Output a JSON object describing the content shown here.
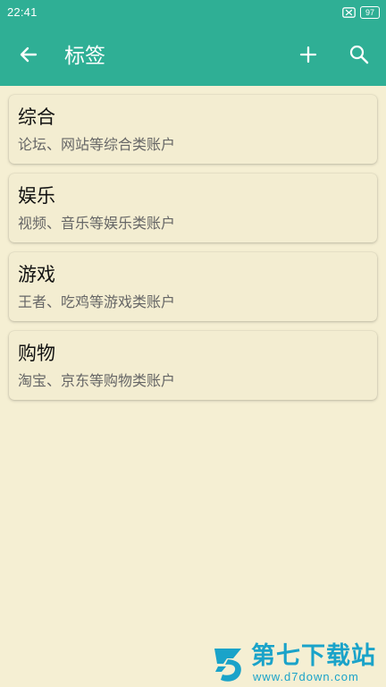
{
  "status_bar": {
    "time": "22:41",
    "battery": "97"
  },
  "app_bar": {
    "title": "标签",
    "icons": {
      "back": "arrow-left",
      "add": "plus",
      "search": "search"
    }
  },
  "tags": [
    {
      "title": "综合",
      "subtitle": "论坛、网站等综合类账户"
    },
    {
      "title": "娱乐",
      "subtitle": "视频、音乐等娱乐类账户"
    },
    {
      "title": "游戏",
      "subtitle": "王者、吃鸡等游戏类账户"
    },
    {
      "title": "购物",
      "subtitle": "淘宝、京东等购物类账户"
    }
  ],
  "watermark": {
    "title": "第七下载站",
    "url": "www.d7down.com"
  },
  "colors": {
    "app_bar": "#2faf95",
    "background": "#f5efd3",
    "card": "#f3edd1",
    "title_text": "#111111",
    "subtitle_text": "#666666",
    "watermark": "#1aa3c9"
  }
}
